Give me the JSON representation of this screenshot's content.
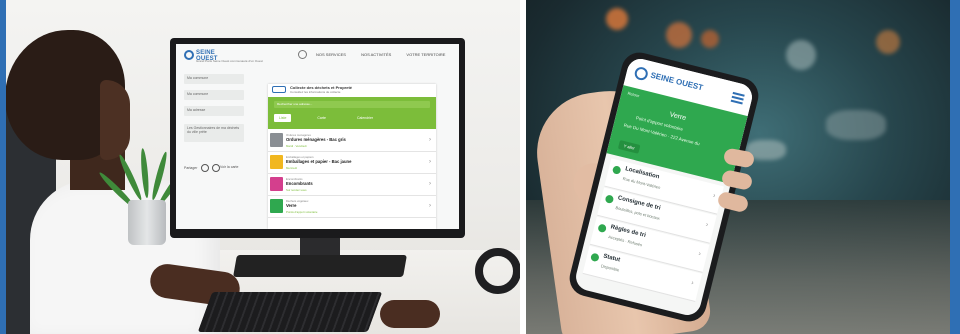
{
  "desktop": {
    "brand": "SEINE OUEST",
    "tagline": "Grand Paris Seine Ouest communauté d'un Ouest",
    "nav": [
      "NOS SERVICES",
      "NOS ACTIVITÉS",
      "VOTRE TERRITOIRE"
    ],
    "sidebar_fields": [
      "Ma commune",
      "Ma commune",
      "Ma adresse",
      "Les Gestionnaires de ma déchets du ville prête"
    ],
    "share_label": "Partager",
    "map_label": "Voir la carte",
    "panel": {
      "title": "Collecte des déchets et Propreté",
      "subtitle": "Consultez les informations de collecte",
      "search_placeholder": "Rechercher une adresse...",
      "tabs": [
        "Liste",
        "Carte",
        "Calendrier"
      ],
      "rows": [
        {
          "category": "Ordures ménagères",
          "title": "Ordures ménagères - Bac gris",
          "meta": "Mardi · Vendredi",
          "color": "#8a8f94"
        },
        {
          "category": "Emballages et papiers",
          "title": "Emballages et papier - Bac jaune",
          "meta": "Mercredi",
          "color": "#f1b71f"
        },
        {
          "category": "Encombrants",
          "title": "Encombrants",
          "meta": "Sur rendez-vous",
          "color": "#d43f8d"
        },
        {
          "category": "Déchets végétaux",
          "title": "Verre",
          "meta": "Points d'apport volontaire",
          "color": "#2fa84f"
        }
      ]
    }
  },
  "mobile": {
    "brand": "SEINE OUEST",
    "back_label": "Retour",
    "title": "Verre",
    "info": "Point d'apport volontaire",
    "address": "Rue Du Mont-Valérien · 222 Avenue du",
    "chip": "Y aller",
    "rows": [
      {
        "label": "Localisation",
        "value": "Rue du Mont-Valérien"
      },
      {
        "label": "Consigne de tri",
        "value": "Bouteilles, pots et bocaux"
      },
      {
        "label": "Règles de tri",
        "value": "Acceptés · Refusés"
      },
      {
        "label": "Statut",
        "value": "Disponible"
      }
    ]
  },
  "colors": {
    "brand_blue": "#2f6fb4",
    "green_web": "#7cbd3a",
    "green_app": "#2fa84f"
  }
}
